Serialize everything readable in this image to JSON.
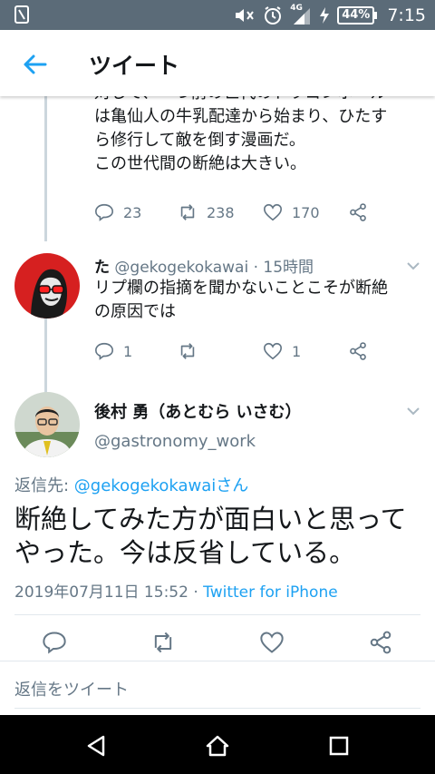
{
  "status_bar": {
    "network": "4G",
    "battery": "44%",
    "time": "7:15"
  },
  "header": {
    "title": "ツイート"
  },
  "tweet1": {
    "lines": [
      "対して、一つ前の世代のドラゴンボール",
      "は亀仙人の牛乳配達から始まり、ひたす",
      "ら修行して敵を倒す漫画だ。",
      "この世代間の断絶は大きい。"
    ],
    "replies": "23",
    "retweets": "238",
    "likes": "170"
  },
  "tweet2": {
    "name": "た",
    "handle": "@gekogekokawai",
    "time": "· 15時間",
    "text_lines": [
      "リプ欄の指摘を聞かないことこそが断絶",
      "の原因では"
    ],
    "replies": "1",
    "retweets": "",
    "likes": "1"
  },
  "tweet3": {
    "name": "後村 勇（あとむら いさむ）",
    "handle": "@gastronomy_work",
    "reply_prefix": "返信先: ",
    "reply_to": "@gekogekokawaiさん",
    "text_lines": [
      "断絶してみた方が面白いと思って",
      "やった。今は反省している。"
    ],
    "datetime": "2019年07月11日 15:52 · ",
    "source": "Twitter for iPhone"
  },
  "reply_box": {
    "placeholder": "返信をツイート"
  },
  "colors": {
    "accent": "#1da1f2",
    "muted": "#657786",
    "status_bar": "#5b6b78"
  }
}
